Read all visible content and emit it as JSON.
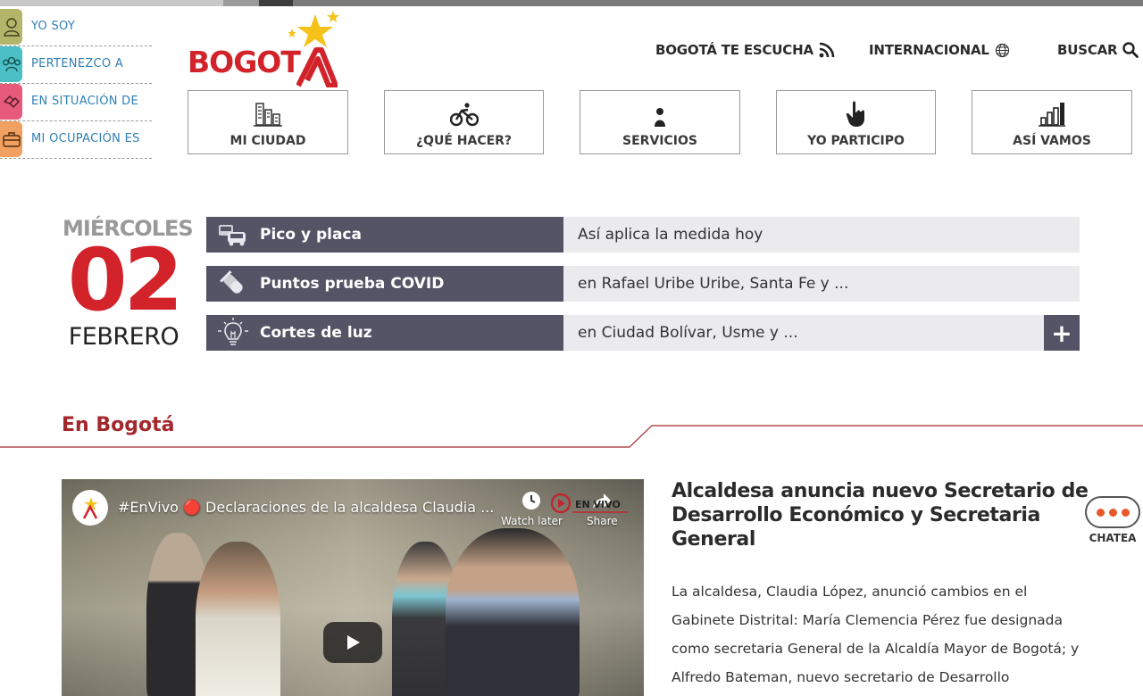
{
  "profile_menu": [
    {
      "label": "YO SOY",
      "icon": "person-icon",
      "color": "#b3b66a"
    },
    {
      "label": "PERTENEZCO A",
      "icon": "group-icon",
      "color": "#4bbfc6"
    },
    {
      "label": "EN SITUACIÓN DE",
      "icon": "handshake-icon",
      "color": "#e65b7b"
    },
    {
      "label": "MI OCUPACIÓN ES",
      "icon": "briefcase-icon",
      "color": "#f0a161"
    }
  ],
  "logo": {
    "text": "BOGOT",
    "brand_color": "#d2232a",
    "star_color": "#f5c21a"
  },
  "top_links": {
    "escucha": "BOGOTÁ TE ESCUCHA",
    "internacional": "INTERNACIONAL",
    "buscar": "BUSCAR"
  },
  "main_nav": [
    {
      "label": "MI CIUDAD",
      "icon": "city-icon"
    },
    {
      "label": "¿QUÉ HACER?",
      "icon": "bicycle-icon"
    },
    {
      "label": "SERVICIOS",
      "icon": "person-service-icon"
    },
    {
      "label": "YO PARTICIPO",
      "icon": "pointing-hand-icon"
    },
    {
      "label": "ASÍ VAMOS",
      "icon": "bar-chart-icon"
    }
  ],
  "date": {
    "weekday": "MIÉRCOLES",
    "day": "02",
    "month": "FEBRERO"
  },
  "info_rows": [
    {
      "label": "Pico y placa",
      "value": "Así aplica la medida hoy",
      "icon": "cars-icon"
    },
    {
      "label": "Puntos prueba COVID",
      "value": "en Rafael Uribe Uribe, Santa Fe y ...",
      "icon": "test-tube-icon"
    },
    {
      "label": "Cortes de luz",
      "value": "en Ciudad Bolívar, Usme y ...",
      "icon": "lightbulb-icon"
    }
  ],
  "section": {
    "title": "En Bogotá",
    "accent": "#a3272d"
  },
  "video": {
    "title": "#EnVivo 🔴 Declaraciones de la alcaldesa Claudia ...",
    "watch_later": "Watch later",
    "share": "Share",
    "live_badge": "EN VIVO"
  },
  "article": {
    "title": "Alcaldesa anuncia nuevo Secretario de Desarrollo Económico y Secretaria General",
    "body": "La alcaldesa, Claudia López, anunció cambios en el Gabinete Distrital: María Clemencia Pérez fue designada como secretaria General de la Alcaldía Mayor de Bogotá; y Alfredo Bateman, nuevo secretario de Desarrollo"
  },
  "chat": {
    "label": "CHATEA"
  }
}
